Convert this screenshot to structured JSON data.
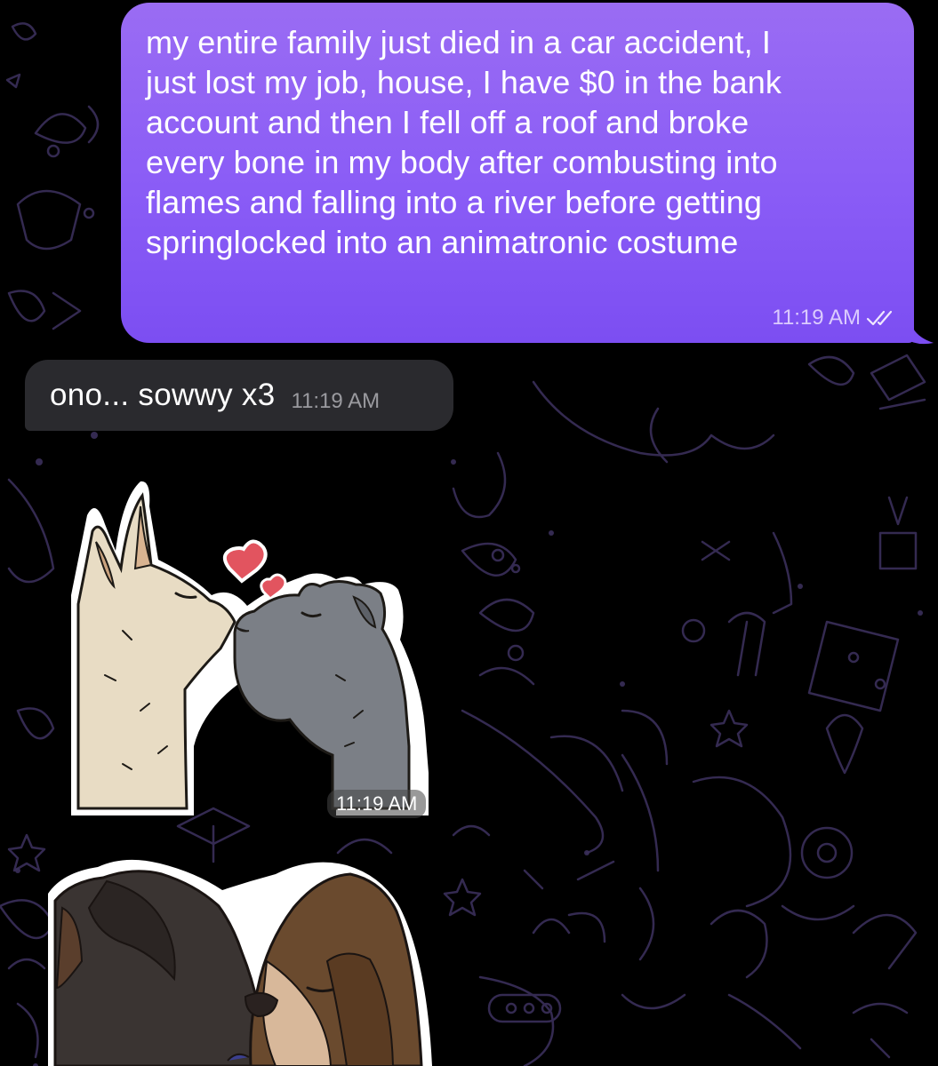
{
  "messages": {
    "outgoing": {
      "lines": [
        "my entire family just died in a car accident, I",
        "just lost my job, house, I have $0 in the bank",
        "account and then I fell off a roof and broke",
        "every bone in my body after combusting into",
        "flames and falling into a river before getting",
        "springlocked into an animatronic costume"
      ],
      "time": "11:19 AM",
      "status_icon": "double-check-read-icon"
    },
    "incoming": {
      "text": "ono... sowwy x3",
      "time": "11:19 AM"
    },
    "sticker_1": {
      "time": "11:19 AM",
      "icon": "kissing-foxes-sticker"
    },
    "sticker_2": {
      "icon": "kissing-dogs-sticker"
    }
  },
  "colors": {
    "background": "#000000",
    "outgoing_bubble": "#8a5cf6",
    "incoming_bubble": "#2a2a2e",
    "doodle_stroke": "#3a2f5a"
  }
}
